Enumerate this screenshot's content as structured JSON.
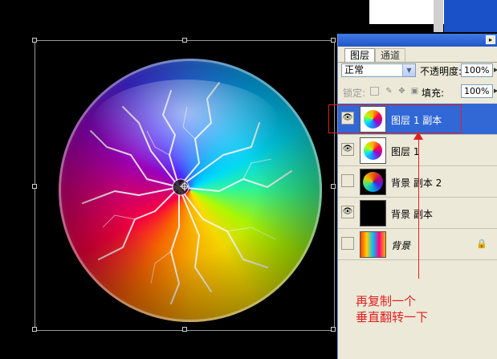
{
  "panel": {
    "tabs": [
      {
        "label": "图层",
        "active": true
      },
      {
        "label": "通道",
        "active": false
      }
    ],
    "blend_mode": {
      "value": "正常"
    },
    "opacity": {
      "label": "不透明度:",
      "value": "100%"
    },
    "lock": {
      "label": "锁定:",
      "icons": [
        "lock-transparent-icon",
        "lock-paint-icon",
        "lock-move-icon",
        "lock-all-icon"
      ]
    },
    "fill": {
      "label": "填充:",
      "value": "100%"
    },
    "layers": [
      {
        "name": "图层 1 副本",
        "visible": true,
        "selected": true,
        "thumb": "orb"
      },
      {
        "name": "图层 1",
        "visible": true,
        "selected": false,
        "thumb": "orb"
      },
      {
        "name": "背景 副本 2",
        "visible": false,
        "selected": false,
        "thumb": "dark-orb"
      },
      {
        "name": "背景 副本",
        "visible": true,
        "selected": false,
        "thumb": "black"
      },
      {
        "name": "背景",
        "visible": false,
        "selected": false,
        "thumb": "fire",
        "locked": true,
        "italic": true
      }
    ]
  },
  "annotation": {
    "line1": "再复制一个",
    "line2": "垂直翻转一下",
    "color": "#e02020"
  },
  "colors": {
    "selection": "#3168d5",
    "panel_bg": "#ece9d8",
    "titlebar": "#2256c8"
  }
}
